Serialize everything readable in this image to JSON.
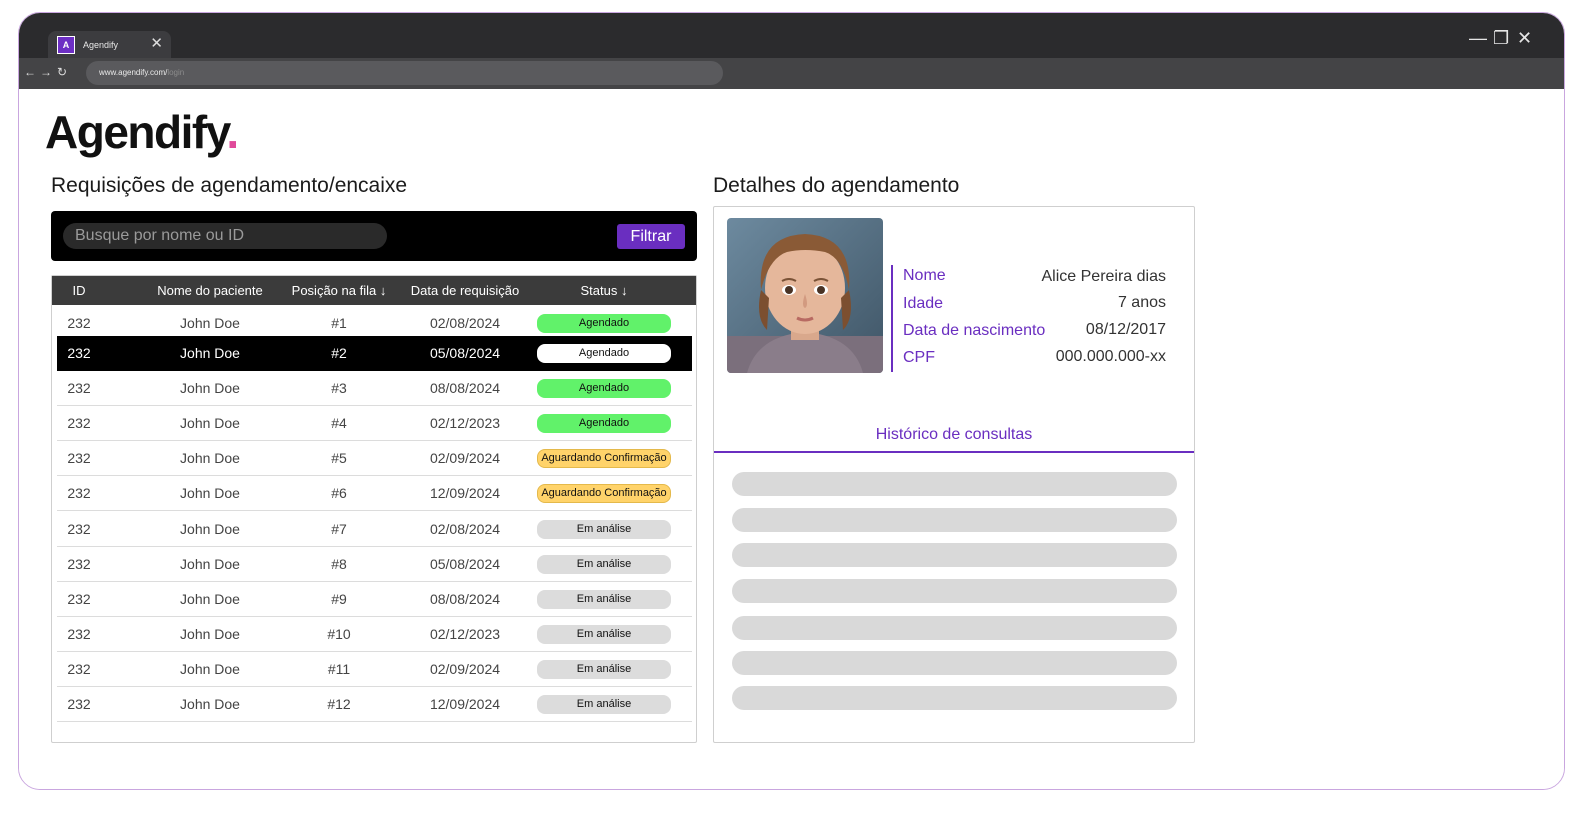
{
  "browser": {
    "tab_favicon_letter": "A",
    "tab_title": "Agendify",
    "url": "www.agendify.com/",
    "url_dim": "login"
  },
  "logo": {
    "text": "Agendify",
    "dot": "."
  },
  "requests": {
    "title": "Requisições de agendamento/encaixe",
    "search_placeholder": "Busque por nome ou ID",
    "filter_label": "Filtrar",
    "columns": [
      "ID",
      "Nome do paciente",
      "Posição na fila ↓",
      "Data de requisição",
      "Status ↓"
    ],
    "rows": [
      {
        "id": "232",
        "name": "John Doe",
        "pos": "#1",
        "date": "02/08/2024",
        "status": "Agendado",
        "status_kind": "agendado"
      },
      {
        "id": "232",
        "name": "John Doe",
        "pos": "#2",
        "date": "05/08/2024",
        "status": "Agendado",
        "status_kind": "selected"
      },
      {
        "id": "232",
        "name": "John Doe",
        "pos": "#3",
        "date": "08/08/2024",
        "status": "Agendado",
        "status_kind": "agendado"
      },
      {
        "id": "232",
        "name": "John Doe",
        "pos": "#4",
        "date": "02/12/2023",
        "status": "Agendado",
        "status_kind": "agendado"
      },
      {
        "id": "232",
        "name": "John Doe",
        "pos": "#5",
        "date": "02/09/2024",
        "status": "Aguardando Confirmação",
        "status_kind": "aguardando"
      },
      {
        "id": "232",
        "name": "John Doe",
        "pos": "#6",
        "date": "12/09/2024",
        "status": "Aguardando Confirmação",
        "status_kind": "aguardando"
      },
      {
        "id": "232",
        "name": "John Doe",
        "pos": "#7",
        "date": "02/08/2024",
        "status": "Em análise",
        "status_kind": "analise"
      },
      {
        "id": "232",
        "name": "John Doe",
        "pos": "#8",
        "date": "05/08/2024",
        "status": "Em análise",
        "status_kind": "analise"
      },
      {
        "id": "232",
        "name": "John Doe",
        "pos": "#9",
        "date": "08/08/2024",
        "status": "Em análise",
        "status_kind": "analise"
      },
      {
        "id": "232",
        "name": "John Doe",
        "pos": "#10",
        "date": "02/12/2023",
        "status": "Em análise",
        "status_kind": "analise"
      },
      {
        "id": "232",
        "name": "John Doe",
        "pos": "#11",
        "date": "02/09/2024",
        "status": "Em análise",
        "status_kind": "analise"
      },
      {
        "id": "232",
        "name": "John Doe",
        "pos": "#12",
        "date": "12/09/2024",
        "status": "Em análise",
        "status_kind": "analise"
      }
    ],
    "selected_row": 1
  },
  "details": {
    "title": "Detalhes do agendamento",
    "fields": [
      {
        "label": "Nome",
        "value": "Alice Pereira dias"
      },
      {
        "label": "Idade",
        "value": "7 anos"
      },
      {
        "label": "Data de nascimento",
        "value": "08/12/2017"
      },
      {
        "label": "CPF",
        "value": "000.000.000-xx"
      }
    ],
    "history_title": "Histórico de consultas"
  },
  "colors": {
    "brand_purple": "#6a2ec0",
    "logo_dot": "#e04a9a",
    "status_agendado": "#61f26a",
    "status_aguardando": "#ffd36a",
    "status_analise": "#dcdcdc"
  },
  "icons": [
    "close-icon",
    "back-arrow-icon",
    "forward-arrow-icon",
    "reload-icon",
    "minimize-icon",
    "restore-icon",
    "window-close-icon"
  ]
}
